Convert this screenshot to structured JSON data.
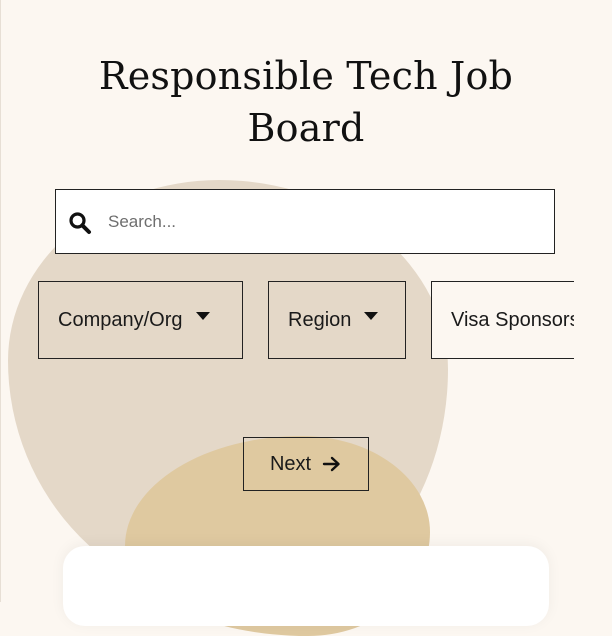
{
  "page": {
    "title": "Responsible Tech Job Board"
  },
  "search": {
    "placeholder": "Search...",
    "value": "",
    "icon": "search-icon"
  },
  "filters": [
    {
      "label": "Company/Org",
      "icon": "caret-down-icon"
    },
    {
      "label": "Region",
      "icon": "caret-down-icon"
    },
    {
      "label": "Visa Sponsorship"
    }
  ],
  "pagination": {
    "next_label": "Next",
    "next_icon": "arrow-right-icon"
  },
  "colors": {
    "background": "#fcf7f1",
    "blob_beige": "#e4d8c8",
    "blob_gold": "#dfc9a0",
    "border": "#222222",
    "text": "#111111"
  }
}
